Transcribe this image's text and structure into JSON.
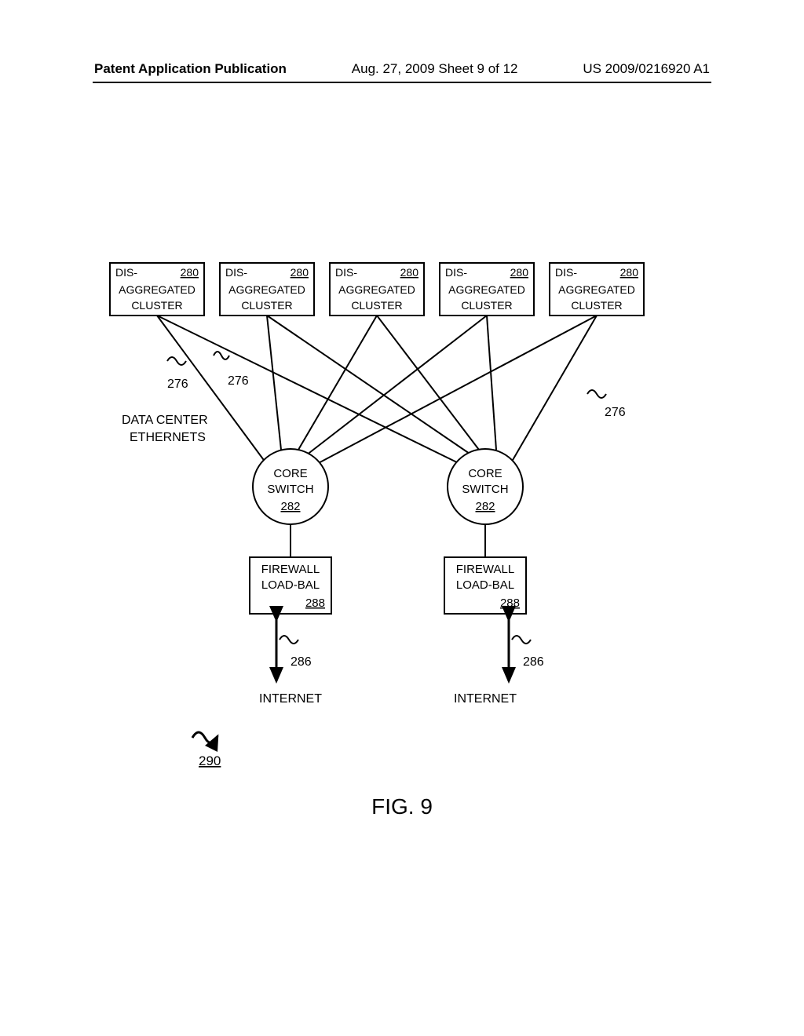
{
  "header": {
    "left": "Patent Application Publication",
    "mid": "Aug. 27, 2009  Sheet 9 of 12",
    "right": "US 2009/0216920 A1"
  },
  "cluster": {
    "line1": "DIS-",
    "line2": "AGGREGATED",
    "line3": "CLUSTER",
    "ref": "280"
  },
  "dce_label": {
    "l1": "DATA CENTER",
    "l2": "ETHERNETS"
  },
  "ref276": "276",
  "coreswitch": {
    "l1": "CORE",
    "l2": "SWITCH",
    "ref": "282"
  },
  "firewall": {
    "l1": "FIREWALL",
    "l2": "LOAD-BAL",
    "ref": "288"
  },
  "ref286": "286",
  "internet": "INTERNET",
  "ref290": "290",
  "figcap": "FIG. 9"
}
